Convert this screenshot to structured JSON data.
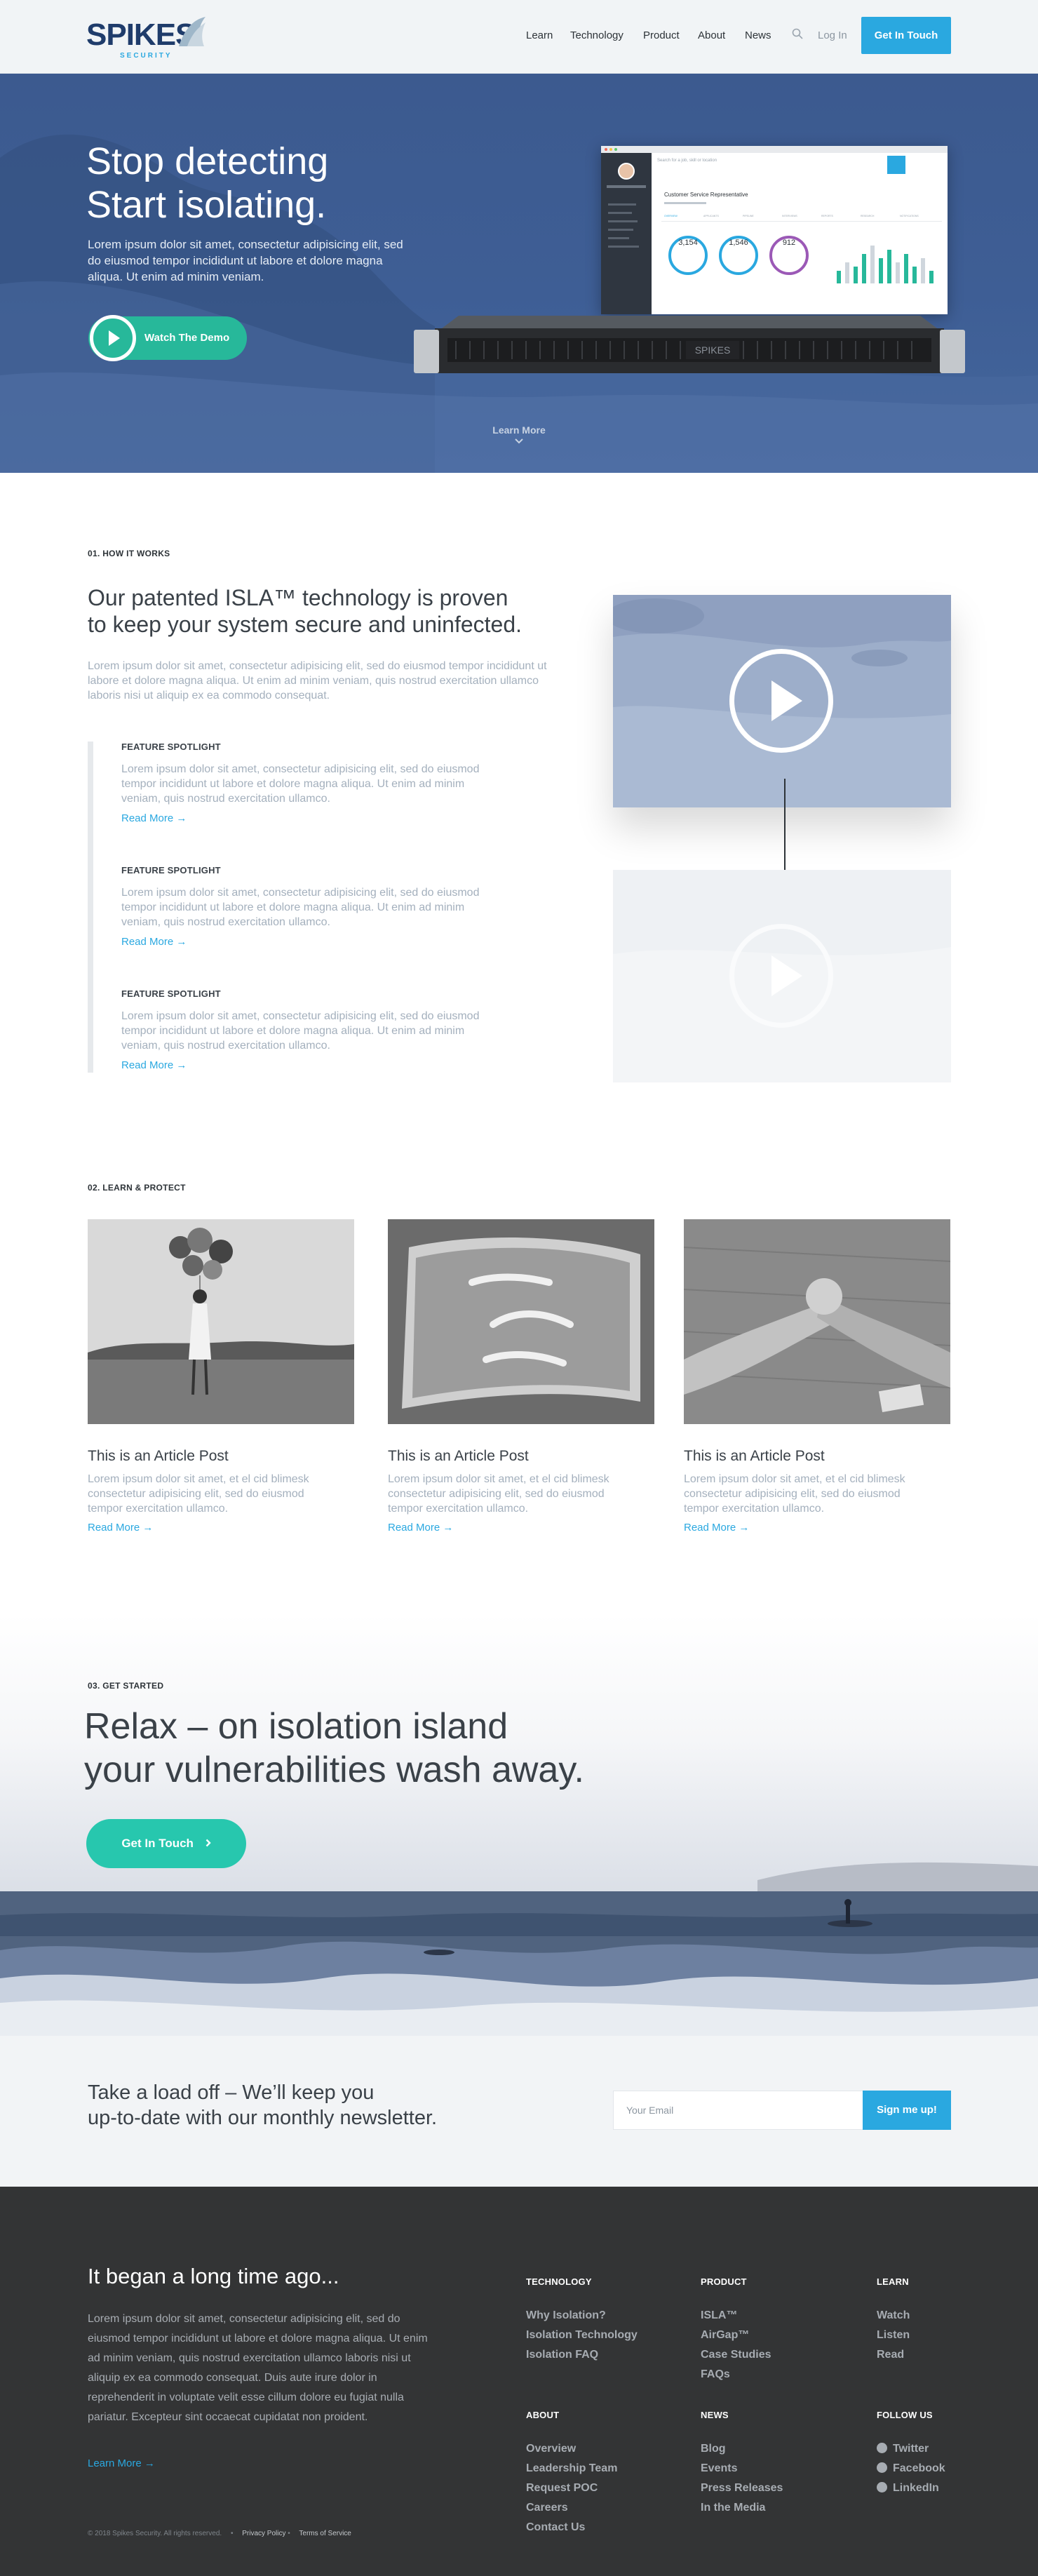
{
  "header": {
    "logo_text": "SPIKES",
    "logo_sub": "SECURITY",
    "nav": [
      "Learn",
      "Technology",
      "Product",
      "About",
      "News"
    ],
    "login": "Log In",
    "cta": "Get In Touch"
  },
  "hero": {
    "title_line1": "Stop detecting",
    "title_line2": "Start isolating.",
    "body": "Lorem ipsum dolor sit amet, consectetur adipisicing elit, sed do eiusmod tempor incididunt ut labore et dolore magna aliqua. Ut enim ad minim veniam.",
    "watch": "Watch The Demo",
    "learn_more": "Learn More",
    "screen": {
      "search_placeholder": "Search for a job, skill or location",
      "profile_title": "Customer Service Representative",
      "tabs": [
        "OVERVIEW",
        "APPLICANTS",
        "PIPELINE",
        "INTERVIEWS",
        "REPORTS",
        "RESEARCH",
        "NOTIFICATIONS"
      ],
      "stats": [
        {
          "value": "3,154",
          "color": "#2aa8e0"
        },
        {
          "value": "1,546",
          "color": "#2aa8e0"
        },
        {
          "value": "912",
          "color": "#9b59b6"
        }
      ],
      "bars": [
        0.3,
        0.5,
        0.4,
        0.7,
        0.9,
        0.6,
        0.8,
        0.5,
        0.7,
        0.4,
        0.6,
        0.3
      ]
    },
    "appliance_label": "SPIKES"
  },
  "how": {
    "eyebrow": "01. HOW IT WORKS",
    "heading_line1": "Our patented ISLA™ technology is proven",
    "heading_line2": "to keep your system secure and uninfected.",
    "body": "Lorem ipsum dolor sit amet, consectetur adipisicing elit, sed do eiusmod tempor incididunt ut labore et dolore magna aliqua. Ut enim ad minim veniam, quis nostrud exercitation ullamco laboris nisi ut aliquip ex ea commodo consequat.",
    "spotlights": [
      {
        "title": "FEATURE SPOTLIGHT",
        "body": "Lorem ipsum dolor sit amet, consectetur adipisicing elit, sed do eiusmod tempor incididunt ut labore et dolore magna aliqua. Ut enim ad minim veniam, quis nostrud exercitation ullamco.",
        "link": "Read More →"
      },
      {
        "title": "FEATURE SPOTLIGHT",
        "body": "Lorem ipsum dolor sit amet, consectetur adipisicing elit, sed do eiusmod tempor incididunt ut labore et dolore magna aliqua. Ut enim ad minim veniam, quis nostrud exercitation ullamco.",
        "link": "Read More →"
      },
      {
        "title": "FEATURE SPOTLIGHT",
        "body": "Lorem ipsum dolor sit amet, consectetur adipisicing elit, sed do eiusmod tempor incididunt ut labore et dolore magna aliqua. Ut enim ad minim veniam, quis nostrud exercitation ullamco.",
        "link": "Read More →"
      }
    ]
  },
  "learn": {
    "eyebrow": "02. LEARN & PROTECT",
    "articles": [
      {
        "title": "This is an Article Post",
        "body": "Lorem ipsum dolor sit amet, et el cid blimesk consectetur adipisicing elit, sed do eiusmod tempor exercitation ullamco.",
        "link": "Read More →"
      },
      {
        "title": "This is an Article Post",
        "body": "Lorem ipsum dolor sit amet, et el cid blimesk consectetur adipisicing elit, sed do eiusmod tempor exercitation ullamco.",
        "link": "Read More →"
      },
      {
        "title": "This is an Article Post",
        "body": "Lorem ipsum dolor sit amet, et el cid blimesk consectetur adipisicing elit, sed do eiusmod tempor exercitation ullamco.",
        "link": "Read More →"
      }
    ]
  },
  "started": {
    "eyebrow": "03. GET STARTED",
    "heading_line1": "Relax – on isolation island",
    "heading_line2": "your vulnerabilities wash away.",
    "cta": "Get In Touch"
  },
  "newsletter": {
    "heading_line1": "Take a load off – We’ll keep you",
    "heading_line2": "up-to-date with our monthly newsletter.",
    "placeholder": "Your Email",
    "button": "Sign me up!"
  },
  "footer": {
    "heading": "It began a long time ago...",
    "body": "Lorem ipsum dolor sit amet, consectetur adipisicing elit, sed do eiusmod tempor incididunt ut labore et dolore magna aliqua. Ut enim ad minim veniam, quis nostrud exercitation ullamco laboris nisi ut aliquip ex ea commodo consequat. Duis aute irure dolor in reprehenderit in voluptate velit esse cillum dolore eu fugiat nulla pariatur. Excepteur sint occaecat cupidatat non proident.",
    "more": "Learn More →",
    "columns": {
      "technology": {
        "heading": "TECHNOLOGY",
        "items": [
          "Why Isolation?",
          "Isolation Technology",
          "Isolation FAQ"
        ]
      },
      "product": {
        "heading": "PRODUCT",
        "items": [
          "ISLA™",
          "AirGap™",
          "Case Studies",
          "FAQs"
        ]
      },
      "learn": {
        "heading": "LEARN",
        "items": [
          "Watch",
          "Listen",
          "Read"
        ]
      },
      "about": {
        "heading": "ABOUT",
        "items": [
          "Overview",
          "Leadership Team",
          "Request POC",
          "Careers",
          "Contact Us"
        ]
      },
      "news": {
        "heading": "NEWS",
        "items": [
          "Blog",
          "Events",
          "Press Releases",
          "In the Media"
        ]
      },
      "follow": {
        "heading": "FOLLOW US",
        "items": [
          "Twitter",
          "Facebook",
          "LinkedIn"
        ]
      }
    },
    "legal": {
      "copyright": "© 2018 Spikes Security. All rights reserved.",
      "privacy": "Privacy Policy",
      "terms": "Terms of Service"
    }
  },
  "colors": {
    "accent": "#2aa8e0",
    "teal": "#27b89a",
    "hero": "#3e5e95",
    "footer": "#333435"
  }
}
